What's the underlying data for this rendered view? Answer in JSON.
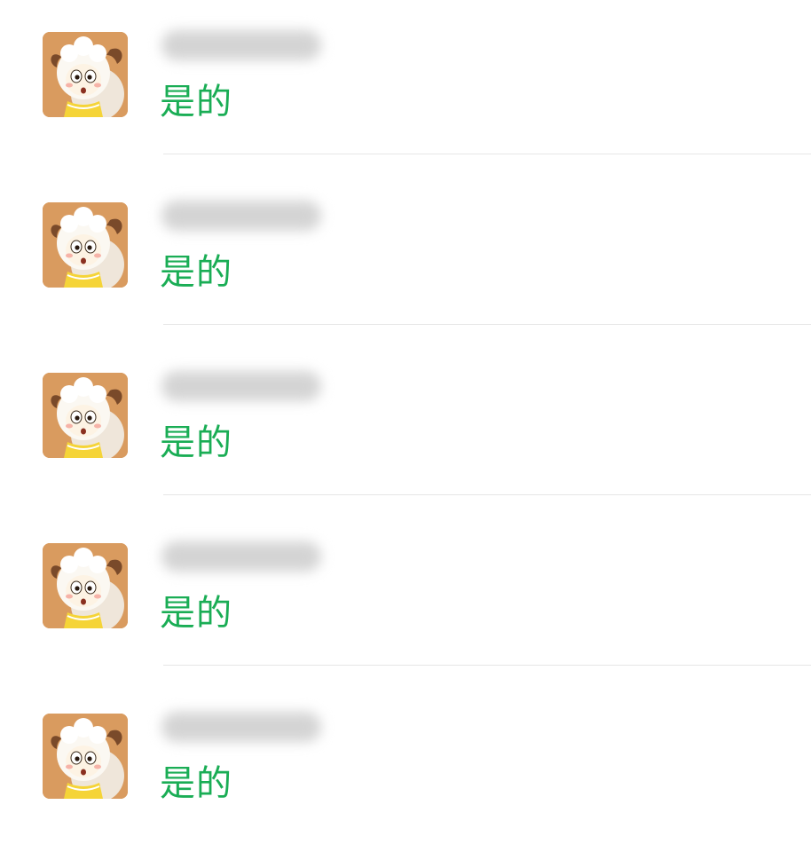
{
  "messages": [
    {
      "sender": "",
      "text": "是的"
    },
    {
      "sender": "",
      "text": "是的"
    },
    {
      "sender": "",
      "text": "是的"
    },
    {
      "sender": "",
      "text": "是的"
    },
    {
      "sender": "",
      "text": "是的"
    }
  ],
  "colors": {
    "message_text": "#1aad55",
    "avatar_bg": "#d99b5f",
    "divider": "#e6e6e6"
  },
  "icons": {
    "avatar": "cartoon-sheep-avatar-icon"
  }
}
